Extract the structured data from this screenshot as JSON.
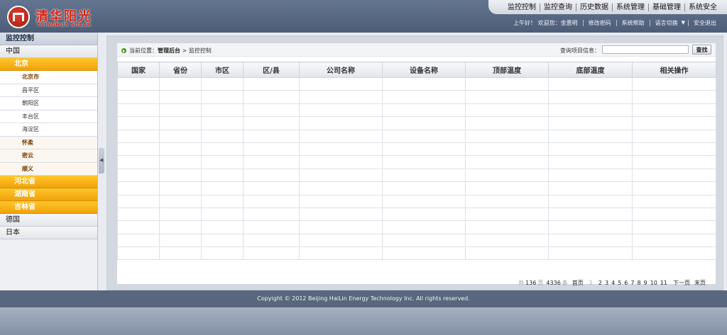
{
  "header": {
    "logo_text": "清华阳光",
    "logo_sub": "TSINGHUA SOLAR",
    "nav": [
      "监控控制",
      "监控查询",
      "历史数据",
      "系统管理",
      "基础管理",
      "系统安全"
    ],
    "user": {
      "greeting": "上午好！ 欢迎您：金惠明",
      "change_password": "修改密码",
      "help": "系统帮助",
      "language": "语言切换",
      "logout": "安全退出"
    }
  },
  "sidebar": {
    "title": "监控控制",
    "country_china": "中国",
    "province_beijing": "北京",
    "cities": [
      "北京市",
      "昌平区",
      "朝阳区",
      "丰台区",
      "海淀区",
      "怀柔",
      "密云",
      "顺义"
    ],
    "other_provinces": [
      "河北省",
      "湖南省",
      "吉林省"
    ],
    "other_countries": [
      "德国",
      "日本"
    ]
  },
  "main": {
    "breadcrumb_prefix": "当前位置：",
    "breadcrumb_home": "管理后台",
    "breadcrumb_sep": " > ",
    "breadcrumb_current": "监控控制",
    "search_label": "查询项目信息：",
    "search_value": "",
    "search_button": "查找",
    "columns": [
      "国家",
      "省份",
      "市区",
      "区/县",
      "公司名称",
      "设备名称",
      "顶部温度",
      "底部温度",
      "相关操作"
    ]
  },
  "pager": {
    "total_prefix": "共",
    "total_pages": "136",
    "pages_unit": "页",
    "total_items": "4336",
    "items_unit": "条",
    "first": "首页",
    "current": "1",
    "pages": [
      "2",
      "3",
      "4",
      "5",
      "6",
      "7",
      "8",
      "9",
      "10",
      "11"
    ],
    "next": "下一页",
    "last": "末页"
  },
  "footer": {
    "copyright": "Copyight © 2012 Beijing HaiLin Energy Technology Inc. All rights reserved."
  }
}
